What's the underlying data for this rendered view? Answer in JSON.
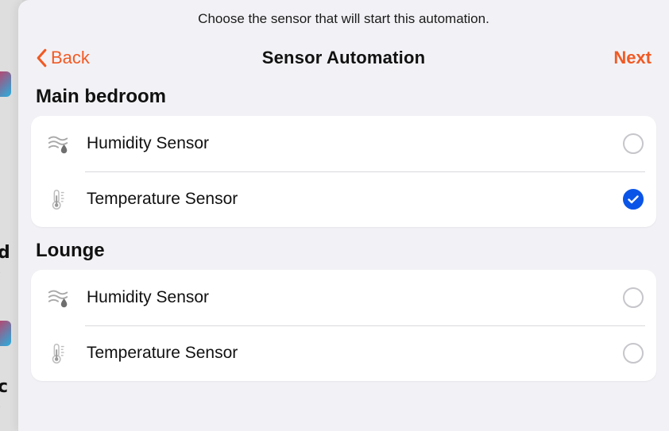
{
  "instruction": "Choose the sensor that will start this automation.",
  "nav": {
    "back_label": "Back",
    "title": "Sensor Automation",
    "next_label": "Next"
  },
  "sections": [
    {
      "title": "Main bedroom",
      "items": [
        {
          "icon": "humidity",
          "label": "Humidity Sensor",
          "selected": false
        },
        {
          "icon": "temperature",
          "label": "Temperature Sensor",
          "selected": true
        }
      ]
    },
    {
      "title": "Lounge",
      "items": [
        {
          "icon": "humidity",
          "label": "Humidity Sensor",
          "selected": false
        },
        {
          "icon": "temperature",
          "label": "Temperature Sensor",
          "selected": false
        }
      ]
    }
  ],
  "colors": {
    "accent": "#f15a24",
    "selected": "#0a55e8"
  }
}
